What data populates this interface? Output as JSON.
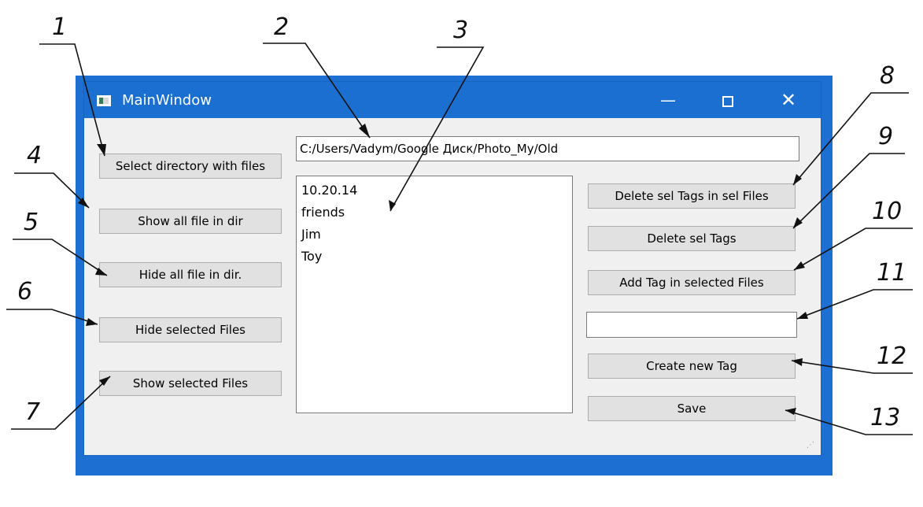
{
  "window": {
    "title": "MainWindow",
    "minimize": "—",
    "close": "✕"
  },
  "left_buttons": {
    "select_dir": "Select directory with files",
    "show_all": "Show  all file in dir",
    "hide_all": "Hide all file in dir.",
    "hide_selected": "Hide selected Files",
    "show_selected": "Show selected Files"
  },
  "path_field": {
    "value": "C:/Users/Vadym/Google Диск/Photo_My/Old"
  },
  "tag_list": {
    "items": [
      "10.20.14",
      "friends",
      "Jim",
      "Toy"
    ]
  },
  "right_buttons": {
    "delete_tags_in_files": "Delete sel Tags in sel Files",
    "delete_tags": "Delete sel Tags",
    "add_tag": "Add Tag in selected Files",
    "create_tag": "Create new Tag",
    "save": "Save"
  },
  "new_tag_field": {
    "value": ""
  },
  "annotations": {
    "labels": [
      "1",
      "2",
      "3",
      "4",
      "5",
      "6",
      "7",
      "8",
      "9",
      "10",
      "11",
      "12",
      "13"
    ]
  },
  "colors": {
    "titlebar": "#1a6fd0",
    "window_bg": "#f0f0f0",
    "button": "#e1e1e1"
  }
}
